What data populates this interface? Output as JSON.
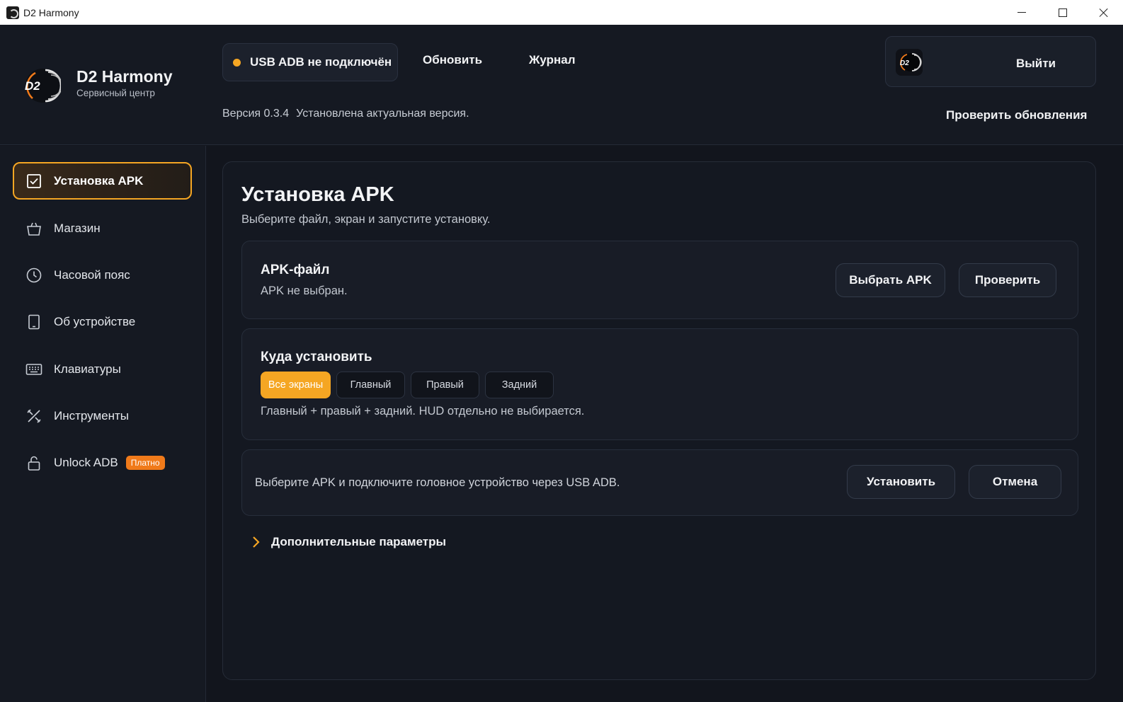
{
  "window": {
    "title": "D2 Harmony",
    "icons": {
      "app": "app-icon",
      "minimize": "minimize-icon",
      "maximize": "maximize-icon",
      "close": "close-icon"
    }
  },
  "header": {
    "brand_name": "D2 Harmony",
    "brand_sub": "Сервисный центр",
    "logo_text": "D2",
    "status_text": "USB ADB не подключён",
    "status_color": "#f5a623",
    "refresh_label": "Обновить",
    "log_label": "Журнал",
    "version": "Версия 0.3.4",
    "version_status": "Установлена актуальная версия.",
    "logout_label": "Выйти",
    "check_updates_label": "Проверить обновления"
  },
  "sidebar": {
    "items": [
      {
        "label": "Установка APK",
        "icon": "checkbox-icon",
        "active": true
      },
      {
        "label": "Магазин",
        "icon": "shopping-bag-icon"
      },
      {
        "label": "Часовой пояс",
        "icon": "clock-icon"
      },
      {
        "label": "Об устройстве",
        "icon": "tablet-icon"
      },
      {
        "label": "Клавиатуры",
        "icon": "keyboard-icon"
      },
      {
        "label": "Инструменты",
        "icon": "tools-icon"
      },
      {
        "label": "Unlock ADB",
        "icon": "lock-icon",
        "badge": "Платно"
      }
    ]
  },
  "main": {
    "title": "Установка APK",
    "subtitle": "Выберите файл, экран и запустите установку.",
    "apk_card": {
      "title": "APK-файл",
      "note": "APK не выбран.",
      "choose_label": "Выбрать APK",
      "verify_label": "Проверить"
    },
    "target_card": {
      "title": "Куда установить",
      "options": [
        "Все экраны",
        "Главный",
        "Правый",
        "Задний"
      ],
      "selected": "Все экраны",
      "note": "Главный + правый + задний. HUD отдельно не выбирается."
    },
    "action_card": {
      "note": "Выберите APK и подключите головное устройство через USB ADB.",
      "install_label": "Установить",
      "cancel_label": "Отмена"
    },
    "advanced_label": "Дополнительные параметры"
  },
  "colors": {
    "accent": "#f5a623",
    "badge": "#f07a1a",
    "background": "#12151d"
  }
}
